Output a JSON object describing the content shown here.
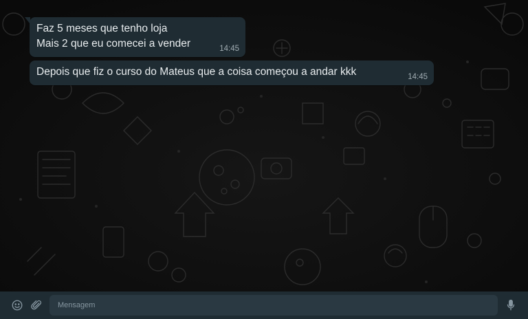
{
  "chat": {
    "messages": [
      {
        "lines": [
          "Faz 5 meses que tenho loja",
          "Mais 2 que eu comecei a vender"
        ],
        "text": "Faz 5 meses que tenho loja\nMais 2 que eu comecei a vender",
        "time": "14:45",
        "direction": "incoming"
      },
      {
        "text": "Depois que fiz o curso do Mateus que a coisa começou a andar kkk",
        "time": "14:45",
        "direction": "incoming"
      }
    ]
  },
  "composer": {
    "placeholder": "Mensagem",
    "emoji_icon": "emoji-icon",
    "attach_icon": "paperclip-icon",
    "mic_icon": "microphone-icon"
  },
  "colors": {
    "background": "#0c0c0c",
    "bubble": "#1f2c33",
    "text": "#e9edef",
    "time": "#a0acb2",
    "composer": "#1f2c33",
    "input": "#2a3942",
    "icon": "#8696a0"
  }
}
